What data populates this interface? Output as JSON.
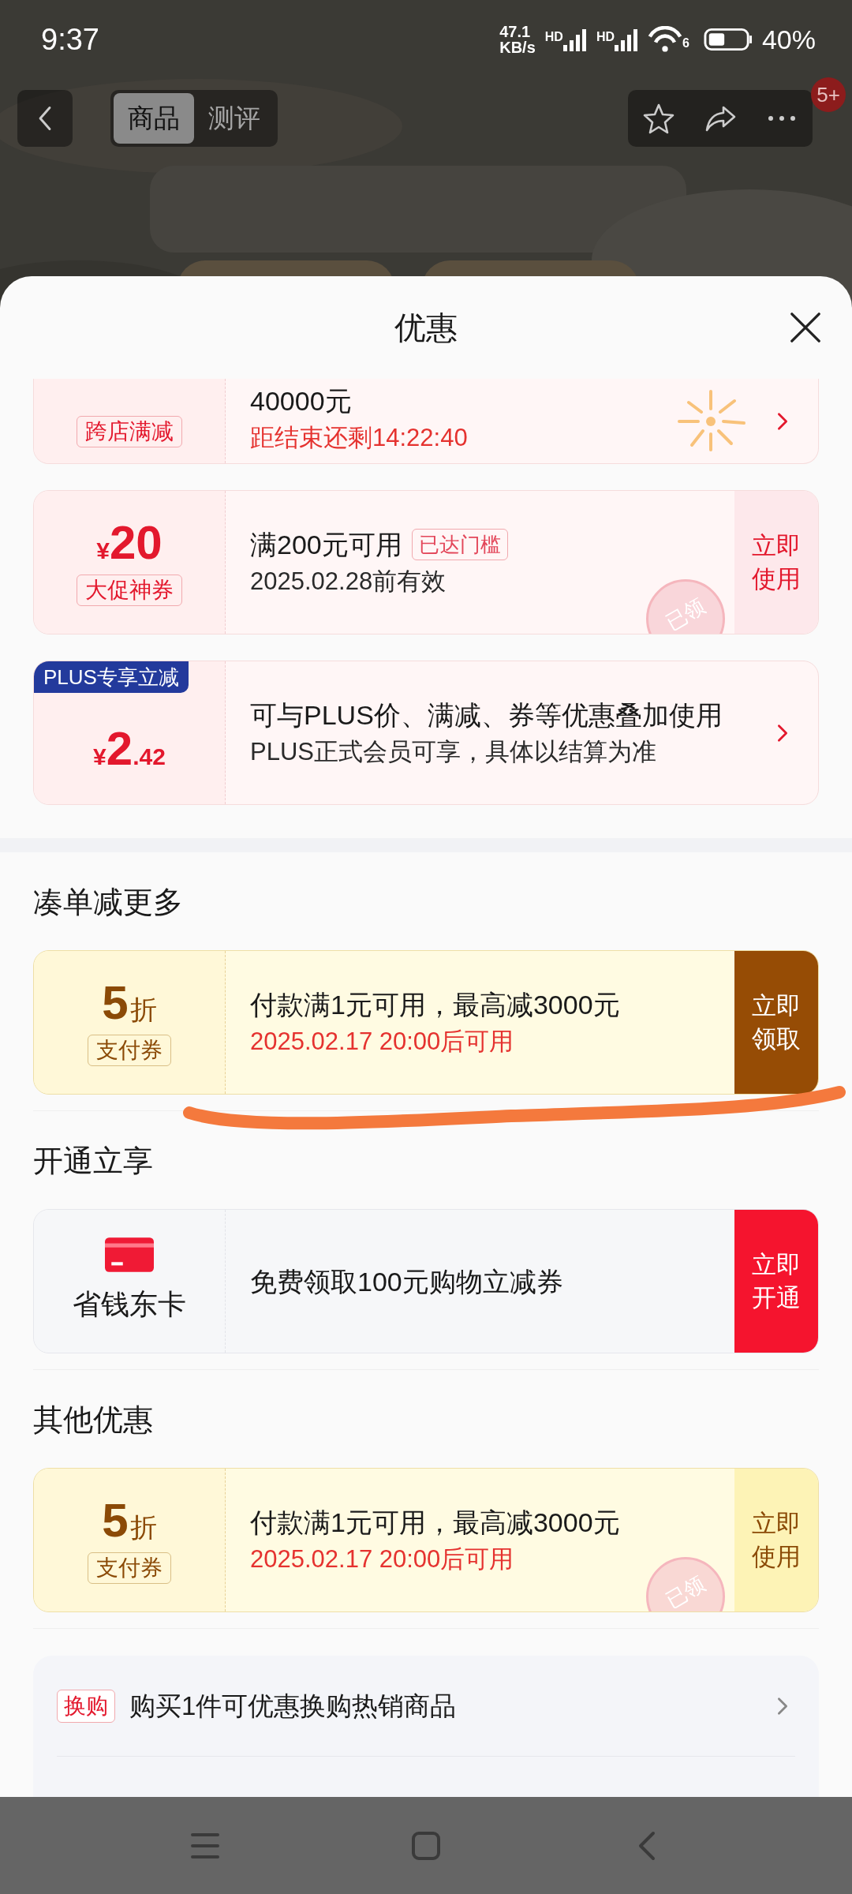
{
  "status_bar": {
    "time": "9:37",
    "net_speed": "47.1",
    "net_speed_unit": "KB/s",
    "sim_labels": [
      "HD",
      "HD"
    ],
    "wifi_label": "6",
    "battery": "40%"
  },
  "top_bar": {
    "tabs": [
      {
        "label": "商品",
        "selected": true
      },
      {
        "label": "测评",
        "selected": false
      }
    ],
    "more_badge": "5+"
  },
  "sheet": {
    "title": "优惠"
  },
  "sections": [
    {
      "coupons": [
        {
          "kind": "flash_sale",
          "partially_visible": true,
          "left": {
            "kind": "amount",
            "tag": "跨店满减"
          },
          "title": "40000元",
          "subtitle": "距结束还剩14:22:40",
          "subtitle_alert": true,
          "action": {
            "kind": "chevron"
          }
        },
        {
          "kind": "discount",
          "partially_visible": false,
          "claimed": true,
          "left": {
            "kind": "amount",
            "currency": "¥",
            "amount": "20",
            "tag": "大促神券"
          },
          "title": "满200元可用",
          "title_badge": "已达门槛",
          "subtitle": "2025.02.28前有效",
          "subtitle_alert": false,
          "action": {
            "kind": "button",
            "label": "立即使用"
          },
          "stamp": "已领"
        },
        {
          "kind": "plus",
          "partially_visible": false,
          "corner_tag": "PLUS专享立减",
          "left": {
            "kind": "amount",
            "currency": "¥",
            "amount": "2",
            "decimal": ".42"
          },
          "title": "可与PLUS价、满减、券等优惠叠加使用",
          "subtitle": "PLUS正式会员可享，具体以结算为准",
          "subtitle_alert": false,
          "action": {
            "kind": "chevron"
          }
        }
      ]
    },
    {
      "heading": "凑单减更多",
      "coupons": [
        {
          "kind": "payment",
          "partially_visible": false,
          "claimed": false,
          "left": {
            "kind": "amount",
            "amount": "5",
            "unit": "折",
            "tag": "支付券"
          },
          "title": "付款满1元可用，最高减3000元",
          "subtitle": "2025.02.17 20:00后可用",
          "subtitle_alert": true,
          "action": {
            "kind": "button",
            "label": "立即领取"
          }
        }
      ]
    },
    {
      "heading": "开通立享",
      "coupons": [
        {
          "kind": "membership",
          "partially_visible": false,
          "claimed": false,
          "left": {
            "kind": "card",
            "label": "省钱东卡"
          },
          "title": "免费领取100元购物立减券",
          "action": {
            "kind": "button",
            "label": "立即开通"
          }
        }
      ]
    },
    {
      "heading": "其他优惠",
      "coupons": [
        {
          "kind": "payment",
          "partially_visible": false,
          "claimed": true,
          "left": {
            "kind": "amount",
            "amount": "5",
            "unit": "折",
            "tag": "支付券"
          },
          "title": "付款满1元可用，最高减3000元",
          "subtitle": "2025.02.17 20:00后可用",
          "subtitle_alert": true,
          "action": {
            "kind": "button",
            "label": "立即使用"
          },
          "stamp": "已领"
        }
      ]
    }
  ],
  "extras": [
    {
      "tag": "换购",
      "text": "购买1件可优惠换购热销商品"
    }
  ]
}
